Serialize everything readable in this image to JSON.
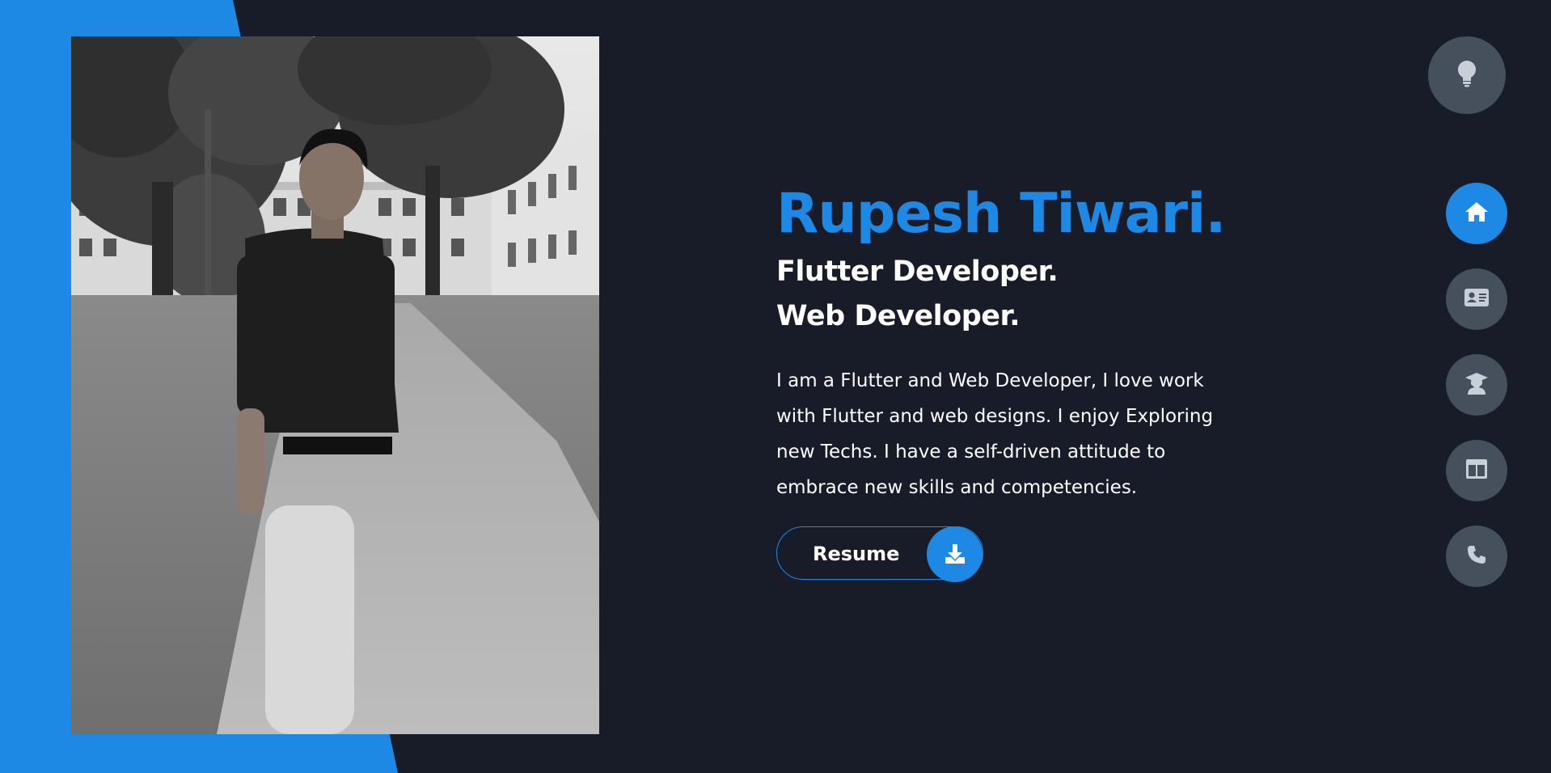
{
  "colors": {
    "accent": "#1e88e5",
    "background": "#181c29",
    "button_gray": "#464f5c",
    "icon_gray": "#c9cfd8",
    "text_white": "#ffffff"
  },
  "hero": {
    "name": "Rupesh Tiwari.",
    "roles": [
      "Flutter Developer.",
      "Web Developer."
    ],
    "bio": "I am a Flutter and Web Developer, I love work with Flutter and web designs. I enjoy Exploring new Techs. I have a self-driven attitude to embrace new skills and competencies.",
    "resume_label": "Resume",
    "resume_icon": "download-icon"
  },
  "photo": {
    "description_icon": "profile-photo"
  },
  "theme_toggle": {
    "icon": "lightbulb-icon"
  },
  "nav": {
    "items": [
      {
        "id": "home",
        "icon": "home-icon",
        "active": true
      },
      {
        "id": "about",
        "icon": "id-card-icon",
        "active": false
      },
      {
        "id": "education",
        "icon": "graduate-icon",
        "active": false
      },
      {
        "id": "portfolio",
        "icon": "layout-icon",
        "active": false
      },
      {
        "id": "contact",
        "icon": "phone-icon",
        "active": false
      }
    ]
  }
}
